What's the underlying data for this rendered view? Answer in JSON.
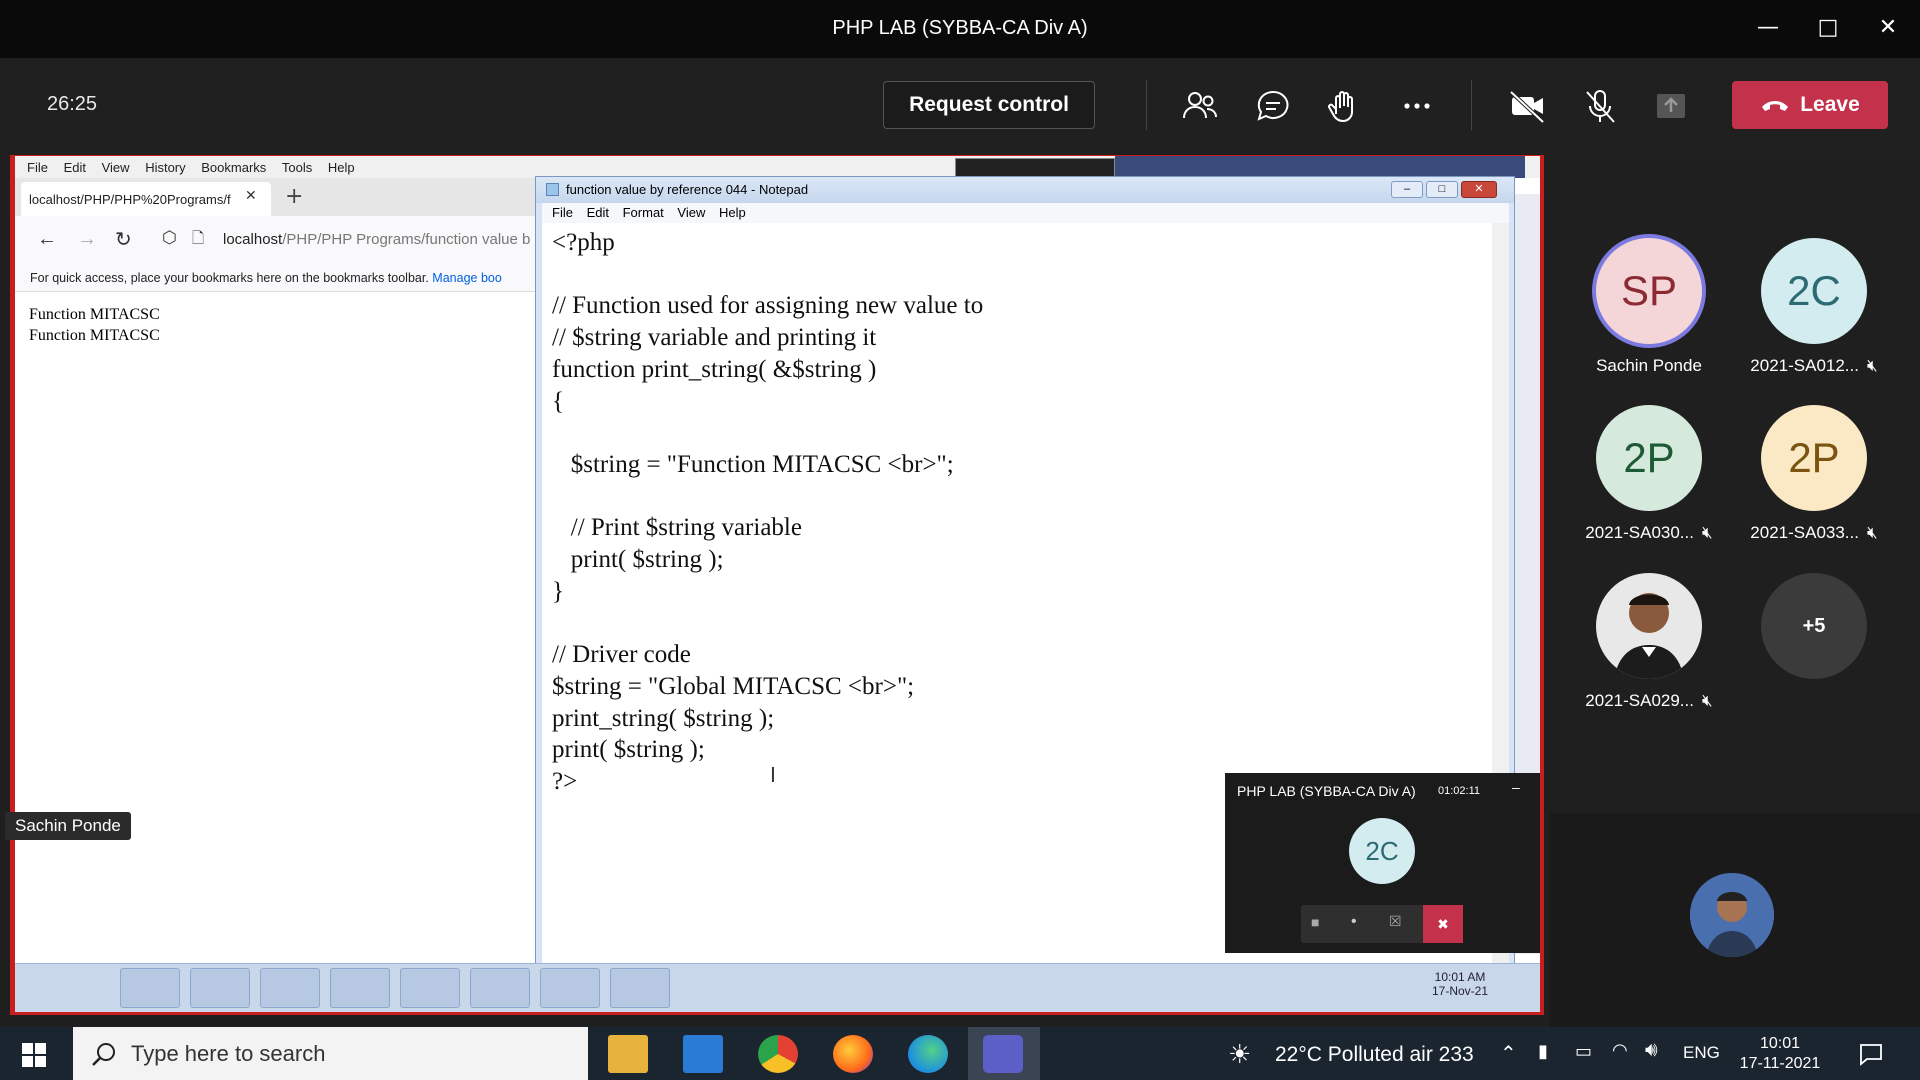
{
  "teams": {
    "window_title": "PHP LAB (SYBBA-CA Div A)",
    "timer": "26:25",
    "request_control_label": "Request control",
    "leave_label": "Leave"
  },
  "firefox": {
    "menu": [
      "File",
      "Edit",
      "View",
      "History",
      "Bookmarks",
      "Tools",
      "Help"
    ],
    "tab_title": "localhost/PHP/PHP%20Programs/f",
    "url_host": "localhost",
    "url_path": "/PHP/PHP Programs/function value b",
    "bookmarks_hint": "For quick access, place your bookmarks here on the bookmarks toolbar.",
    "bookmarks_link": "Manage boo",
    "output_lines": [
      "Function MITACSC",
      "Function MITACSC"
    ]
  },
  "notepad": {
    "title": "function value by reference 044 - Notepad",
    "menu": [
      "File",
      "Edit",
      "Format",
      "View",
      "Help"
    ],
    "code": "<?php\n\n// Function used for assigning new value to\n// $string variable and printing it\nfunction print_string( &$string )\n{\n\n   $string = \"Function MITACSC <br>\";\n\n   // Print $string variable\n   print( $string );\n}\n\n// Driver code\n$string = \"Global MITACSC <br>\";\nprint_string( $string );\nprint( $string );\n?>"
  },
  "mini_call": {
    "title": "PHP LAB (SYBBA-CA Div A)",
    "duration": "01:02:11",
    "avatar_initials": "2C"
  },
  "shared_taskbar": {
    "time": "10:01 AM",
    "date": "17-Nov-21"
  },
  "presenter": "Sachin Ponde",
  "participants": [
    {
      "initials": "SP",
      "name": "Sachin Ponde",
      "muted": false,
      "bg": "#f4d6d8",
      "fg": "#8b2a33",
      "ring": true
    },
    {
      "initials": "2C",
      "name": "2021-SA012...",
      "muted": true,
      "bg": "#d3ecef",
      "fg": "#2c6b73",
      "ring": false
    },
    {
      "initials": "2P",
      "name": "2021-SA030...",
      "muted": true,
      "bg": "#d6e9dd",
      "fg": "#1f5a36",
      "ring": false
    },
    {
      "initials": "2P",
      "name": "2021-SA033...",
      "muted": true,
      "bg": "#fbe8c4",
      "fg": "#7a5410",
      "ring": false
    },
    {
      "initials": "",
      "name": "2021-SA029...",
      "muted": true,
      "bg": "#e8e8e8",
      "fg": "#333",
      "ring": false,
      "photo": true
    },
    {
      "initials": "+5",
      "name": "",
      "muted": false,
      "bg": "#3b3b3b",
      "fg": "#ffffff",
      "ring": false
    }
  ],
  "windows_taskbar": {
    "search_placeholder": "Type here to search",
    "weather": "22°C  Polluted air 233",
    "lang": "ENG",
    "time": "10:01",
    "date": "17-11-2021"
  }
}
